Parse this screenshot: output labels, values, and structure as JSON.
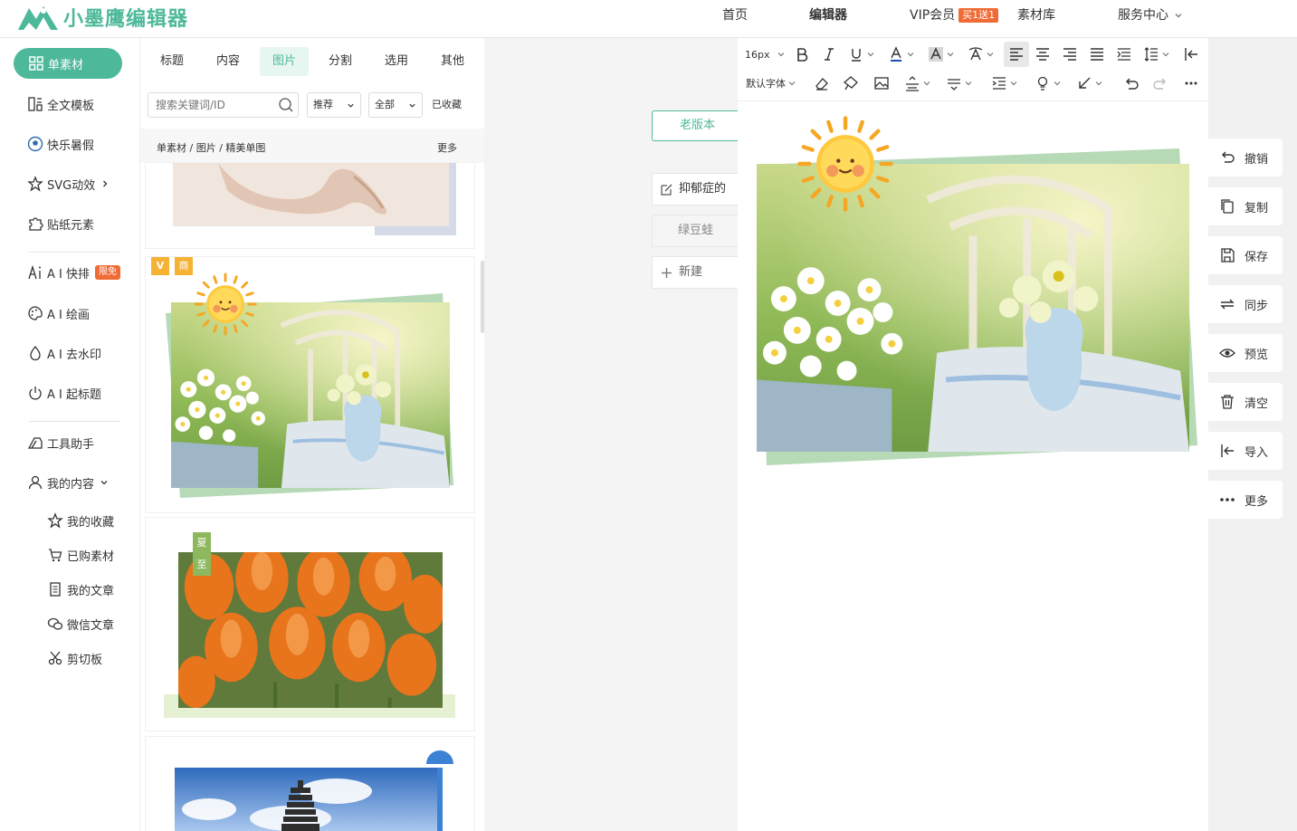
{
  "header": {
    "logo_text": "小墨鹰编辑器",
    "nav": [
      "首页",
      "编辑器",
      "VIP会员",
      "素材库",
      "服务中心"
    ],
    "vip_badge": "买1送1",
    "brand_color": "#4db89a"
  },
  "left_nav": {
    "items": [
      {
        "label": "单素材",
        "icon": "grid-icon"
      },
      {
        "label": "全文模板",
        "icon": "template-icon"
      },
      {
        "label": "快乐暑假",
        "icon": "soccer-ball-icon"
      },
      {
        "label": "SVG动效",
        "icon": "star-icon"
      },
      {
        "label": "贴纸元素",
        "icon": "puzzle-icon"
      },
      {
        "label": "A I 快排",
        "icon": "ai-icon",
        "badge": "限免"
      },
      {
        "label": "A I 绘画",
        "icon": "palette-icon"
      },
      {
        "label": "A I 去水印",
        "icon": "drop-icon"
      },
      {
        "label": "A I 起标题",
        "icon": "power-icon"
      },
      {
        "label": "工具助手",
        "icon": "tools-icon"
      },
      {
        "label": "我的内容",
        "icon": "user-icon"
      }
    ],
    "sub_items": [
      {
        "label": "我的收藏",
        "icon": "star-outline-icon"
      },
      {
        "label": "已购素材",
        "icon": "cart-icon"
      },
      {
        "label": "我的文章",
        "icon": "document-icon"
      },
      {
        "label": "微信文章",
        "icon": "wechat-icon"
      },
      {
        "label": "剪切板",
        "icon": "scissors-icon"
      }
    ]
  },
  "material": {
    "tabs": [
      "标题",
      "内容",
      "图片",
      "分割",
      "选用",
      "其他"
    ],
    "active_tab": "图片",
    "search_placeholder": "搜索关键词/ID",
    "filters": [
      "推荐",
      "全部"
    ],
    "favorites": "已收藏",
    "breadcrumb": "单素材 / 图片 / 精美单图",
    "more": "更多",
    "card_tags": {
      "vip": "V",
      "commercial": "商",
      "summer_a": "夏",
      "summer_b": "至"
    }
  },
  "documents": {
    "old_version": "老版本",
    "items": [
      "抑郁症的",
      "绿豆蛙"
    ],
    "new_label": "新建"
  },
  "toolbar": {
    "font_size": "16px",
    "font_family": "默认字体"
  },
  "right_actions": [
    {
      "label": "撤销",
      "icon": "undo-icon"
    },
    {
      "label": "复制",
      "icon": "copy-icon"
    },
    {
      "label": "保存",
      "icon": "save-icon"
    },
    {
      "label": "同步",
      "icon": "sync-icon"
    },
    {
      "label": "预览",
      "icon": "eye-icon"
    },
    {
      "label": "清空",
      "icon": "trash-icon"
    },
    {
      "label": "导入",
      "icon": "import-icon"
    },
    {
      "label": "更多",
      "icon": "more-icon"
    }
  ]
}
